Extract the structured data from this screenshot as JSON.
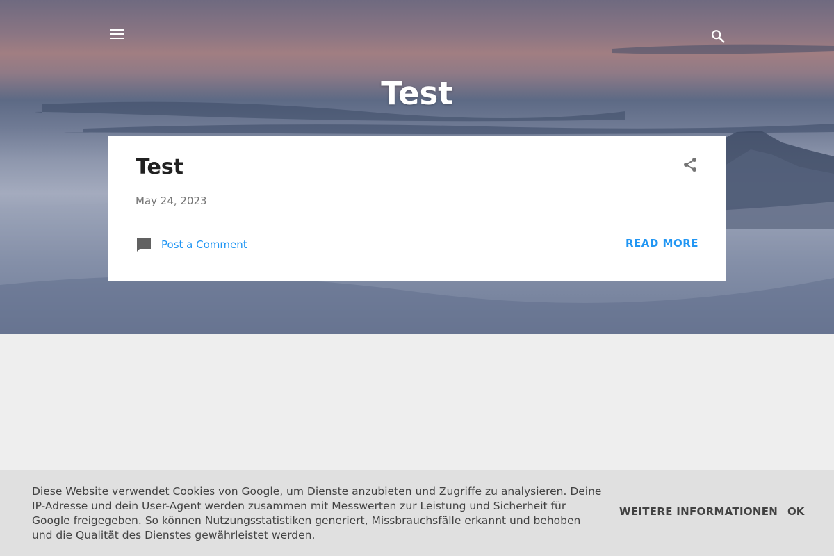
{
  "header": {
    "menu_icon": "hamburger-menu-icon",
    "search_icon": "search-icon",
    "blog_title": "Test"
  },
  "post": {
    "title": "Test",
    "date": "May 24, 2023",
    "share_icon": "share-icon",
    "comment_icon": "comment-icon",
    "comment_label": "Post a Comment",
    "read_more_label": "READ MORE"
  },
  "cookie_notice": {
    "text": "Diese Website verwendet Cookies von Google, um Dienste anzubieten und Zugriffe zu analysieren. Deine IP-Adresse und dein User-Agent werden zusammen mit Messwerten zur Leistung und Sicherheit für Google freigegeben. So können Nutzungsstatistiken generiert, Missbrauchsfälle erkannt und behoben und die Qualität des Dienstes gewährleistet werden.",
    "more_info_label": "WEITERE INFORMATIONEN",
    "ok_label": "OK"
  },
  "colors": {
    "accent": "#2196f3",
    "page_background": "#eeeeee",
    "card_background": "#ffffff",
    "cookie_bar_background": "#e0e0e0"
  }
}
